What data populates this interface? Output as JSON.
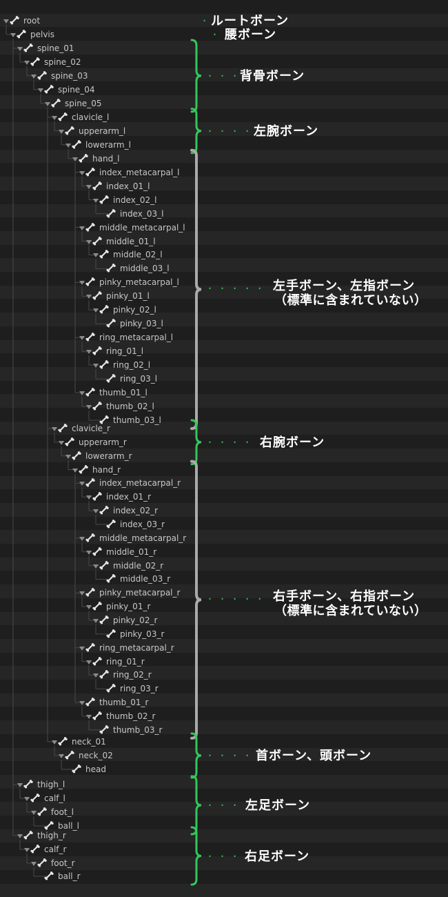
{
  "colors": {
    "background": "#1e1e1e",
    "row_alt": "#262626",
    "tree_line": "#4a4a4a",
    "label": "#c8c8c8",
    "bracket_green": "#35c75a",
    "bracket_gray": "#a9aba8",
    "annotation_text": "#ffffff"
  },
  "icons": {
    "expander": "triangle-down-icon",
    "bone": "bone-icon"
  },
  "bones": [
    {
      "name": "root",
      "depth": 0,
      "exp": true
    },
    {
      "name": "pelvis",
      "depth": 1,
      "exp": true
    },
    {
      "name": "spine_01",
      "depth": 2,
      "exp": true
    },
    {
      "name": "spine_02",
      "depth": 3,
      "exp": true
    },
    {
      "name": "spine_03",
      "depth": 4,
      "exp": true
    },
    {
      "name": "spine_04",
      "depth": 5,
      "exp": true
    },
    {
      "name": "spine_05",
      "depth": 6,
      "exp": true
    },
    {
      "name": "clavicle_l",
      "depth": 7,
      "exp": true
    },
    {
      "name": "upperarm_l",
      "depth": 8,
      "exp": true
    },
    {
      "name": "lowerarm_l",
      "depth": 9,
      "exp": true
    },
    {
      "name": "hand_l",
      "depth": 10,
      "exp": true
    },
    {
      "name": "index_metacarpal_l",
      "depth": 11,
      "exp": true
    },
    {
      "name": "index_01_l",
      "depth": 12,
      "exp": true
    },
    {
      "name": "index_02_l",
      "depth": 13,
      "exp": true
    },
    {
      "name": "index_03_l",
      "depth": 14,
      "exp": false
    },
    {
      "name": "middle_metacarpal_l",
      "depth": 11,
      "exp": true
    },
    {
      "name": "middle_01_l",
      "depth": 12,
      "exp": true
    },
    {
      "name": "middle_02_l",
      "depth": 13,
      "exp": true
    },
    {
      "name": "middle_03_l",
      "depth": 14,
      "exp": false
    },
    {
      "name": "pinky_metacarpal_l",
      "depth": 11,
      "exp": true
    },
    {
      "name": "pinky_01_l",
      "depth": 12,
      "exp": true
    },
    {
      "name": "pinky_02_l",
      "depth": 13,
      "exp": true
    },
    {
      "name": "pinky_03_l",
      "depth": 14,
      "exp": false
    },
    {
      "name": "ring_metacarpal_l",
      "depth": 11,
      "exp": true
    },
    {
      "name": "ring_01_l",
      "depth": 12,
      "exp": true
    },
    {
      "name": "ring_02_l",
      "depth": 13,
      "exp": true
    },
    {
      "name": "ring_03_l",
      "depth": 14,
      "exp": false
    },
    {
      "name": "thumb_01_l",
      "depth": 11,
      "exp": true
    },
    {
      "name": "thumb_02_l",
      "depth": 12,
      "exp": true
    },
    {
      "name": "thumb_03_l",
      "depth": 13,
      "exp": false
    },
    {
      "name": "clavicle_r",
      "depth": 7,
      "exp": true
    },
    {
      "name": "upperarm_r",
      "depth": 8,
      "exp": true
    },
    {
      "name": "lowerarm_r",
      "depth": 9,
      "exp": true
    },
    {
      "name": "hand_r",
      "depth": 10,
      "exp": true
    },
    {
      "name": "index_metacarpal_r",
      "depth": 11,
      "exp": true
    },
    {
      "name": "index_01_r",
      "depth": 12,
      "exp": true
    },
    {
      "name": "index_02_r",
      "depth": 13,
      "exp": true
    },
    {
      "name": "index_03_r",
      "depth": 14,
      "exp": false
    },
    {
      "name": "middle_metacarpal_r",
      "depth": 11,
      "exp": true
    },
    {
      "name": "middle_01_r",
      "depth": 12,
      "exp": true
    },
    {
      "name": "middle_02_r",
      "depth": 13,
      "exp": true
    },
    {
      "name": "middle_03_r",
      "depth": 14,
      "exp": false
    },
    {
      "name": "pinky_metacarpal_r",
      "depth": 11,
      "exp": true
    },
    {
      "name": "pinky_01_r",
      "depth": 12,
      "exp": true
    },
    {
      "name": "pinky_02_r",
      "depth": 13,
      "exp": true
    },
    {
      "name": "pinky_03_r",
      "depth": 14,
      "exp": false
    },
    {
      "name": "ring_metacarpal_r",
      "depth": 11,
      "exp": true
    },
    {
      "name": "ring_01_r",
      "depth": 12,
      "exp": true
    },
    {
      "name": "ring_02_r",
      "depth": 13,
      "exp": true
    },
    {
      "name": "ring_03_r",
      "depth": 14,
      "exp": false
    },
    {
      "name": "thumb_01_r",
      "depth": 11,
      "exp": true
    },
    {
      "name": "thumb_02_r",
      "depth": 12,
      "exp": true
    },
    {
      "name": "thumb_03_r",
      "depth": 13,
      "exp": false
    },
    {
      "name": "neck_01",
      "depth": 7,
      "exp": true
    },
    {
      "name": "neck_02",
      "depth": 8,
      "exp": true
    },
    {
      "name": "head",
      "depth": 9,
      "exp": false
    },
    {
      "name": "thigh_l",
      "depth": 2,
      "exp": true
    },
    {
      "name": "calf_l",
      "depth": 3,
      "exp": true
    },
    {
      "name": "foot_l",
      "depth": 4,
      "exp": true
    },
    {
      "name": "ball_l",
      "depth": 5,
      "exp": false
    },
    {
      "name": "thigh_r",
      "depth": 2,
      "exp": true
    },
    {
      "name": "calf_r",
      "depth": 3,
      "exp": true
    },
    {
      "name": "foot_r",
      "depth": 4,
      "exp": true
    },
    {
      "name": "ball_r",
      "depth": 5,
      "exp": false
    }
  ],
  "annotations": [
    {
      "id": "root",
      "text": "ルートボーン",
      "dots": "·",
      "first": 0,
      "last": 0,
      "bracket": "none"
    },
    {
      "id": "pelvis",
      "text": "腰ボーン",
      "dots": "· ·",
      "first": 1,
      "last": 1,
      "bracket": "none"
    },
    {
      "id": "spine",
      "text": "背骨ボーン",
      "dots": "· · ·",
      "first": 2,
      "last": 6,
      "bracket": "green"
    },
    {
      "id": "left-arm",
      "text": "左腕ボーン",
      "dots": "· · · ·",
      "first": 7,
      "last": 9,
      "bracket": "green"
    },
    {
      "id": "left-hand",
      "text": "左手ボーン、左指ボーン",
      "sub": "（標準に含まれていない）",
      "dots": "· · · · ·",
      "first": 10,
      "last": 29,
      "bracket": "gray"
    },
    {
      "id": "right-arm",
      "text": "右腕ボーン",
      "dots": "· · · ·",
      "first": 30,
      "last": 32,
      "bracket": "green"
    },
    {
      "id": "right-hand",
      "text": "右手ボーン、右指ボーン",
      "sub": "（標準に含まれていない）",
      "dots": "· · · · ·",
      "first": 33,
      "last": 52,
      "bracket": "gray"
    },
    {
      "id": "neck-head",
      "text": "首ボーン、頭ボーン",
      "dots": "· · · ·",
      "first": 53,
      "last": 55,
      "bracket": "green"
    },
    {
      "id": "left-leg",
      "text": "左足ボーン",
      "dots": "· · ·",
      "first": 56,
      "last": 59,
      "bracket": "green"
    },
    {
      "id": "right-leg",
      "text": "右足ボーン",
      "dots": "· · ·",
      "first": 60,
      "last": 63,
      "bracket": "green"
    }
  ]
}
